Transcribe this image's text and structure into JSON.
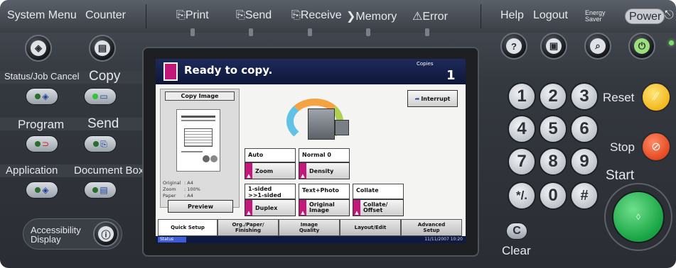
{
  "top_bar": {
    "system_menu": "System Menu",
    "counter": "Counter",
    "print": "Print",
    "send": "Send",
    "receive": "Receive",
    "memory": "Memory",
    "error": "Error",
    "help": "Help",
    "logout": "Logout",
    "energy_saver_line1": "Energy",
    "energy_saver_line2": "Saver",
    "power": "Power"
  },
  "left_keys": {
    "status_job_cancel": "Status/Job Cancel",
    "copy": "Copy",
    "program": "Program",
    "send": "Send",
    "application": "Application",
    "document_box": "Document Box",
    "accessibility_line1": "Accessibility",
    "accessibility_line2": "Display"
  },
  "screen": {
    "status_title": "Ready to copy.",
    "copies_label": "Copies",
    "copies_value": "1",
    "interrupt": "Interrupt",
    "copy_image": "Copy Image",
    "info": [
      {
        "key": "Original",
        "value": ": A4"
      },
      {
        "key": "Zoom",
        "value": ": 100%"
      },
      {
        "key": "Paper",
        "value": ": A4"
      }
    ],
    "preview": "Preview",
    "auto": "Auto",
    "zoom": "Zoom",
    "normal0": "Normal 0",
    "density": "Density",
    "one_sided_line1": "1-sided",
    "one_sided_line2": ">>1-sided",
    "duplex": "Duplex",
    "text_photo": "Text+Photo",
    "original_image_line1": "Original",
    "original_image_line2": "Image",
    "collate": "Collate",
    "collate_offset_line1": "Collate/",
    "collate_offset_line2": "Offset",
    "tabs": [
      {
        "line1": "Quick Setup",
        "line2": ""
      },
      {
        "line1": "Org./Paper/",
        "line2": "Finishing"
      },
      {
        "line1": "Image",
        "line2": "Quality"
      },
      {
        "line1": "Layout/Edit",
        "line2": ""
      },
      {
        "line1": "Advanced",
        "line2": "Setup"
      }
    ],
    "status_label": "Status",
    "datetime": "11/11/2007  10:20"
  },
  "keypad": {
    "keys": [
      "1",
      "2",
      "3",
      "4",
      "5",
      "6",
      "7",
      "8",
      "9",
      "*/.",
      "0",
      "#"
    ],
    "clear_key": "C",
    "clear": "Clear",
    "reset": "Reset",
    "stop": "Stop",
    "start": "Start"
  },
  "colors": {
    "panel": "#2e3238",
    "reset_button": "#f7c21f",
    "stop_button": "#e8532e",
    "start_button": "#1fa84a",
    "screen_title_bar": "#14204a",
    "screen_accent": "#c2187a"
  }
}
